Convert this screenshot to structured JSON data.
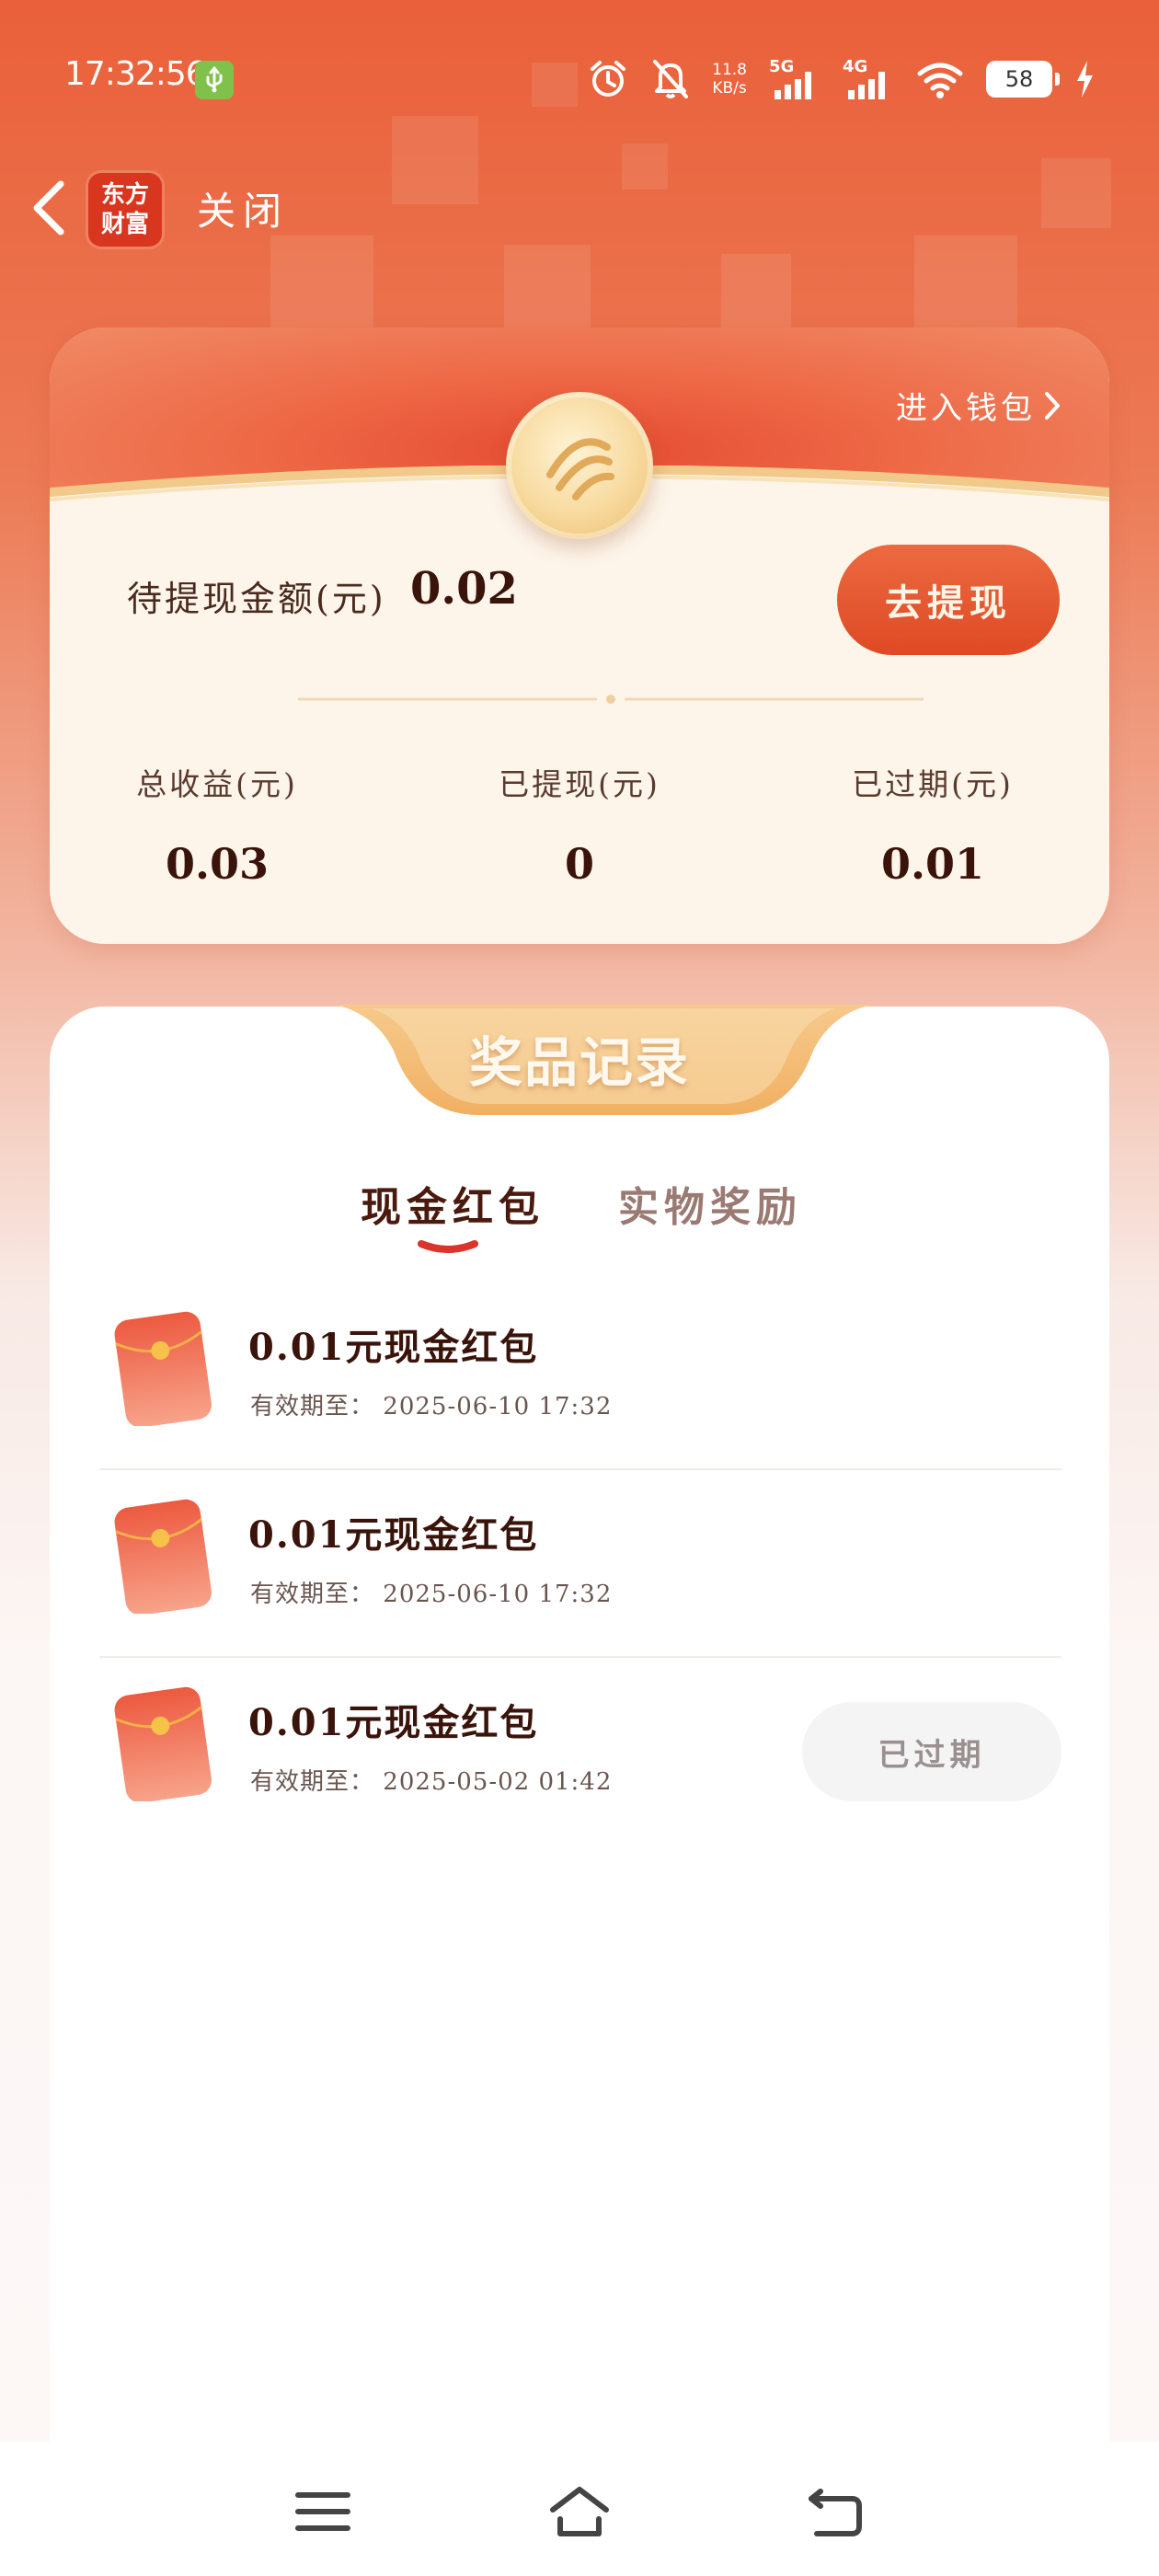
{
  "status_bar": {
    "time": "17:32:56",
    "net_speed_value": "11.8",
    "net_speed_unit": "KB/s",
    "signal_1": "5G",
    "signal_2": "4G",
    "battery": "58"
  },
  "nav": {
    "logo_line1": "东方",
    "logo_line2": "财富",
    "close_label": "关闭"
  },
  "wallet": {
    "enter_wallet": "进入钱包",
    "pending_label": "待提现金额(元)",
    "pending_value": "0.02",
    "withdraw_button": "去提现",
    "stats": [
      {
        "label": "总收益(元)",
        "value": "0.03"
      },
      {
        "label": "已提现(元)",
        "value": "0"
      },
      {
        "label": "已过期(元)",
        "value": "0.01"
      }
    ],
    "accent_color": "#de4a24"
  },
  "records": {
    "title": "奖品记录",
    "tabs": [
      {
        "label": "现金红包",
        "active": true
      },
      {
        "label": "实物奖励",
        "active": false
      }
    ],
    "items": [
      {
        "title": "0.01元现金红包",
        "expiry_prefix": "有效期至：",
        "expiry": "2025-06-10 17:32",
        "status": ""
      },
      {
        "title": "0.01元现金红包",
        "expiry_prefix": "有效期至：",
        "expiry": "2025-06-10 17:32",
        "status": ""
      },
      {
        "title": "0.01元现金红包",
        "expiry_prefix": "有效期至：",
        "expiry": "2025-05-02 01:42",
        "status": "已过期"
      }
    ]
  }
}
